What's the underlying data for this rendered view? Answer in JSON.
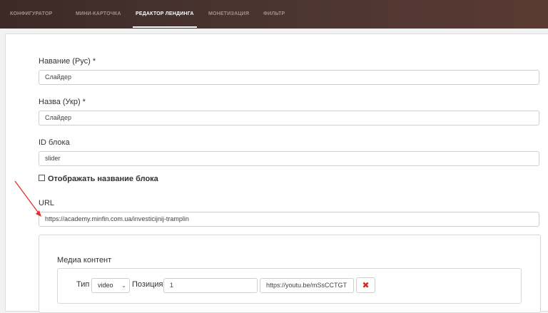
{
  "nav": {
    "tabs": [
      {
        "label": "КОНФИГУРАТОР"
      },
      {
        "label": "МИНИ-КАРТОЧКА"
      },
      {
        "label": "РЕДАКТОР ЛЕНДИНГА"
      },
      {
        "label": "МОНЕТИЗАЦИЯ"
      },
      {
        "label": "ФИЛЬТР"
      }
    ],
    "active": "РЕДАКТОР ЛЕНДИНГА"
  },
  "form": {
    "name_ru": {
      "label": "Навание (Рус) *",
      "value": "Слайдер"
    },
    "name_ua": {
      "label": "Назва (Укр) *",
      "value": "Слайдер"
    },
    "block_id": {
      "label": "ID блока",
      "value": "slider"
    },
    "show_title": {
      "label": "Отображать название блока",
      "checked": false
    },
    "url": {
      "label": "URL",
      "value": "https://academy.minfin.com.ua/investicijnij-tramplin"
    }
  },
  "media": {
    "title": "Медиа контент",
    "type_label": "Тип",
    "type_value": "video",
    "position_label": "Позиция",
    "position_value": "1",
    "link_value": "https://youtu.be/mSsCCTGT",
    "delete_glyph": "✖"
  },
  "colors": {
    "topbar": "#4a3430",
    "active_tab": "#ffffff",
    "inactive_tab": "#a58f88",
    "annotation_arrow": "#e0302a",
    "delete": "#c9302c"
  }
}
